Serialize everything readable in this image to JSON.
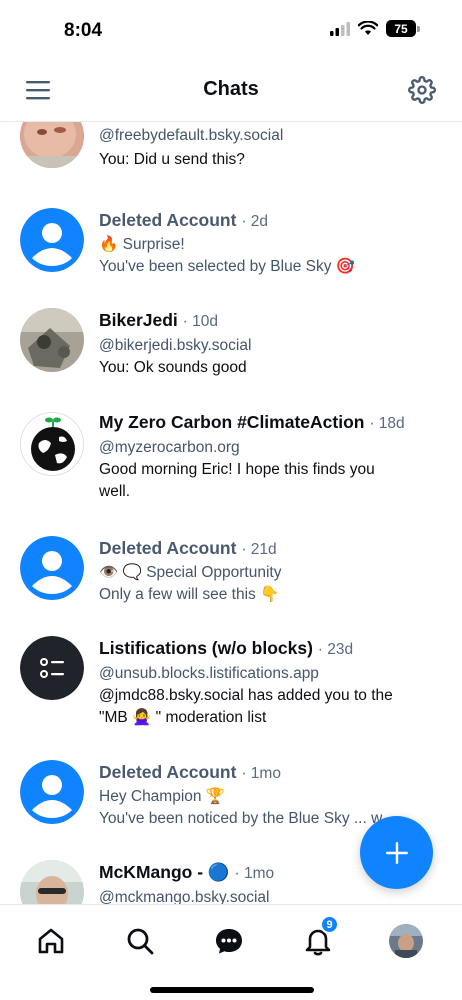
{
  "status_bar": {
    "time": "8:04",
    "battery": "75"
  },
  "header": {
    "title": "Chats"
  },
  "chats": [
    {
      "name": "",
      "time": "",
      "handle": "@freebydefault.bsky.social",
      "message": "You: Did u send this?"
    },
    {
      "name": "Deleted Account",
      "time": "· 2d",
      "line1": "🔥 Surprise!",
      "line2": "You've been selected by Blue Sky 🎯"
    },
    {
      "name": "BikerJedi",
      "time": "· 10d",
      "handle": "@bikerjedi.bsky.social",
      "message": "You: Ok sounds good"
    },
    {
      "name": "My Zero Carbon #ClimateAction",
      "time": "· 18d",
      "handle": "@myzerocarbon.org",
      "message_line1": "Good morning Eric!  I hope this finds you",
      "message_line2": "well."
    },
    {
      "name": "Deleted Account",
      "time": "· 21d",
      "line1": "👁️ 🗨️ Special Opportunity",
      "line2": "Only a few will see this 👇"
    },
    {
      "name": "Listifications (w/o blocks)",
      "time": "· 23d",
      "handle": "@unsub.blocks.listifications.app",
      "message_line1": "@jmdc88.bsky.social has added you to the",
      "message_line2": "\"MB 🙅‍♀️ \" moderation list"
    },
    {
      "name": "Deleted Account",
      "time": "· 1mo",
      "line1": "Hey Champion 🏆",
      "line2": "You've been noticed by the Blue Sky ... w..."
    },
    {
      "name": "McKMango - 🔵",
      "time": "· 1mo",
      "handle": "@mckmango.bsky.social"
    }
  ],
  "bottom_nav": {
    "items": [
      "home-icon",
      "search-icon",
      "chat-icon",
      "bell-icon",
      "profile-avatar"
    ],
    "notification_badge": "9"
  },
  "colors": {
    "accent": "#1083fe",
    "text": "#0b0f14",
    "muted": "#45566b",
    "divider": "#e6e9ee"
  }
}
